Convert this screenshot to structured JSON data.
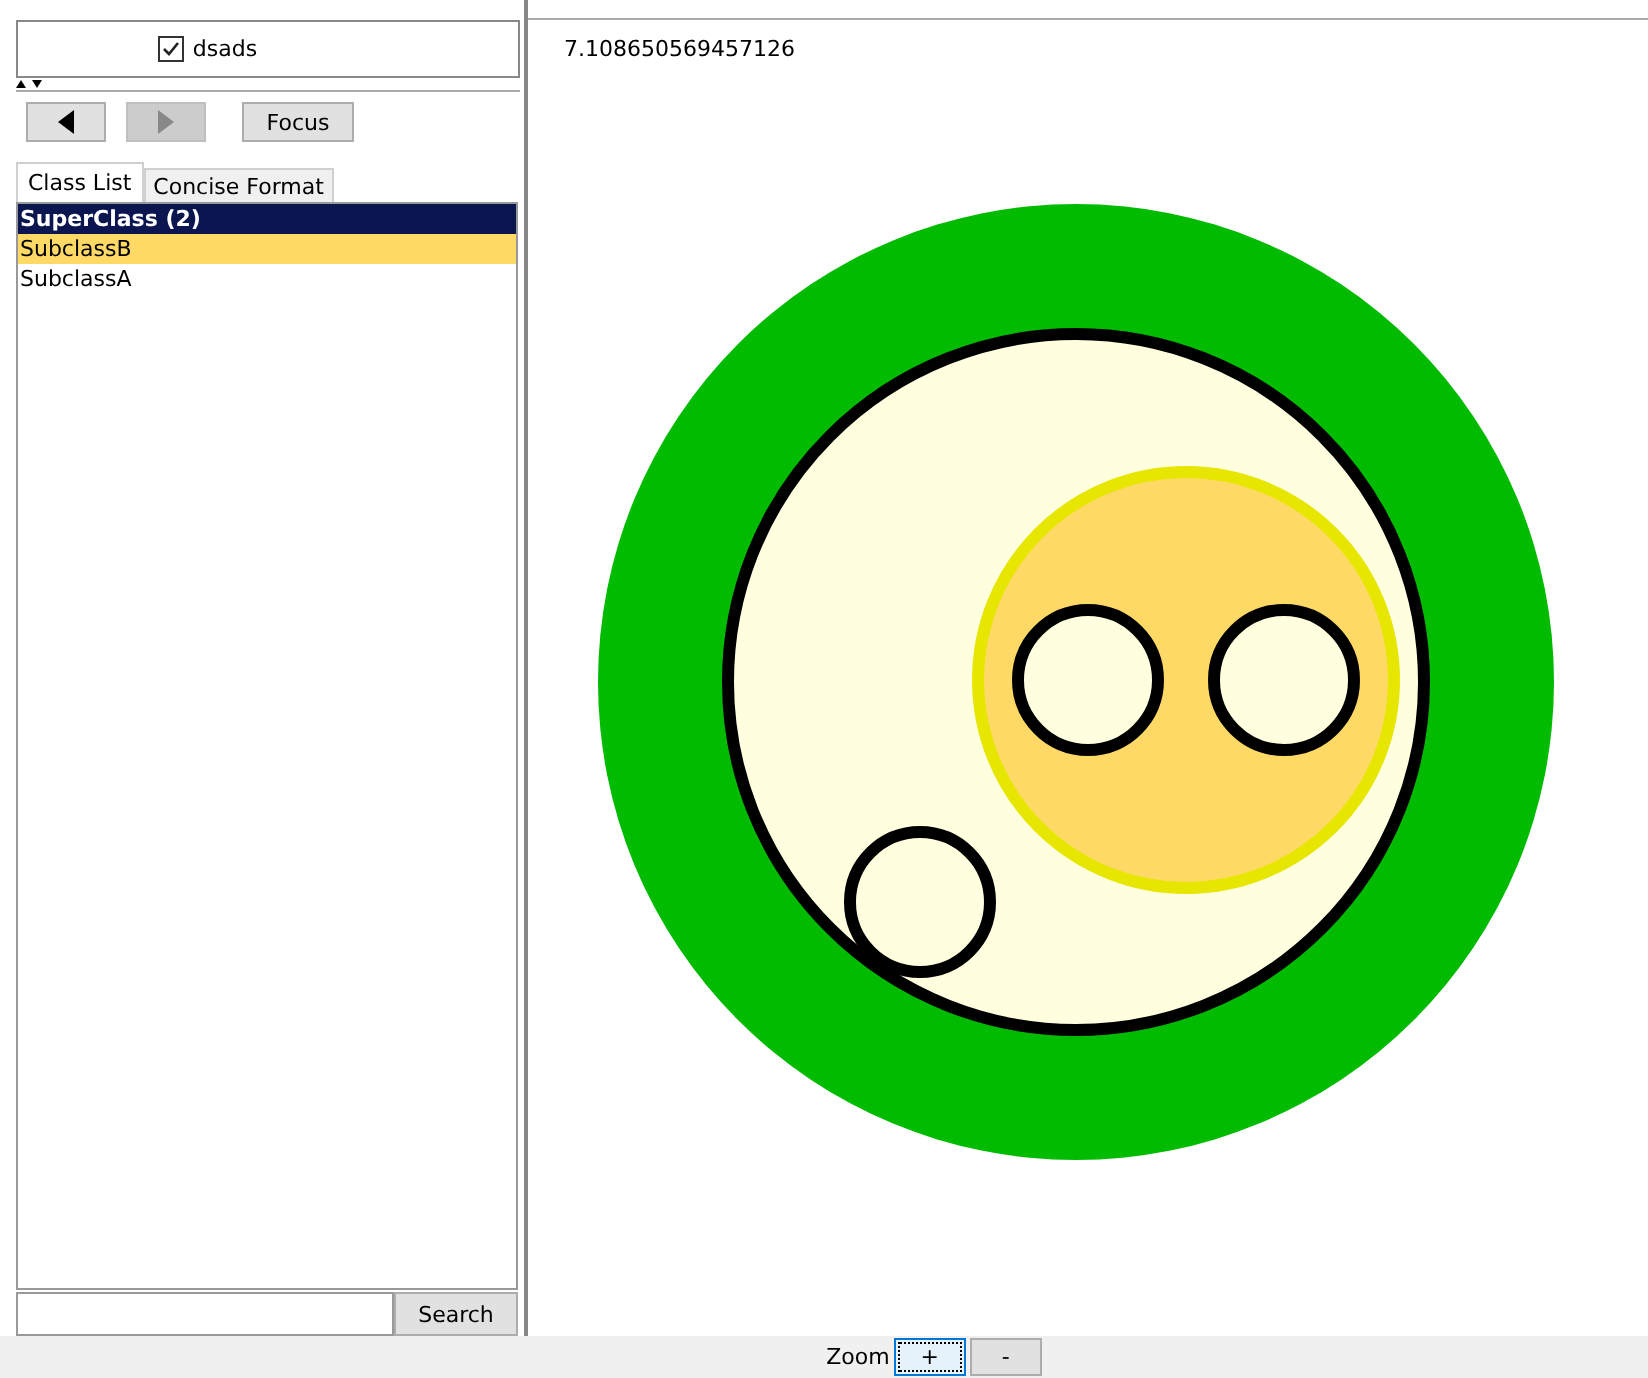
{
  "top_checkbox": {
    "label": "dsads",
    "checked": true
  },
  "nav_buttons": [
    {
      "kind": "back",
      "disabled": false
    },
    {
      "kind": "forward",
      "disabled": true
    }
  ],
  "focus_button": "Focus",
  "tabs": [
    {
      "label": "Class List",
      "selected": true
    },
    {
      "label": "Concise Format",
      "selected": false
    }
  ],
  "class_list": [
    {
      "label": "SuperClass (2)",
      "kind": "header",
      "selected": false
    },
    {
      "label": "SubclassB",
      "kind": "item",
      "selected": true
    },
    {
      "label": "SubclassA",
      "kind": "item",
      "selected": false
    }
  ],
  "search_button": "Search",
  "canvas": {
    "value_text": "7.108650569457126"
  },
  "zoom": {
    "label": "Zoom",
    "buttons": [
      {
        "label": "+",
        "focused": true
      },
      {
        "label": "-",
        "focused": false
      }
    ]
  }
}
